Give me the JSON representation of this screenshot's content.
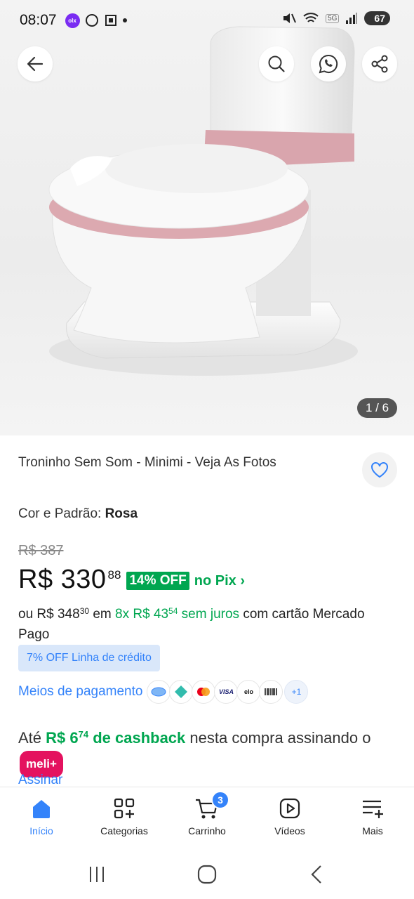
{
  "status_bar": {
    "time": "08:07",
    "app_badge": "olx",
    "network_tag": "5G",
    "battery": "67"
  },
  "hero": {
    "image_counter": "1 / 6",
    "icons": [
      "arrow-left-icon",
      "search-icon",
      "whatsapp-icon",
      "share-icon"
    ]
  },
  "product": {
    "title": "Troninho Sem Som - Minimi - Veja As Fotos",
    "variant_label": "Cor e Padrão:",
    "variant_value": "Rosa",
    "old_price": "R$ 387",
    "price_integer": "R$ 330",
    "price_cents": "88",
    "discount_badge": "14% OFF",
    "pix_label": "no Pix",
    "installments": {
      "prefix": "ou R$ 348",
      "prefix_cents": "30",
      "middle": " em ",
      "count": "8x R$ 43",
      "count_cents": "54",
      "no_interest": " sem juros",
      "suffix": " com cartão Mercado Pago"
    },
    "credit_chip": "7% OFF Linha de crédito",
    "payment_link": "Meios de pagamento",
    "payment_more": "+1",
    "cashback": {
      "prefix": "Até ",
      "amount": "R$ 6",
      "amount_cents": "74",
      "label": " de cashback",
      "suffix": " nesta compra assinando o ",
      "pill": "meli+"
    },
    "subscribe_link": "Assinar"
  },
  "bottom_nav": {
    "items": [
      {
        "label": "Início",
        "icon": "home-icon",
        "active": true
      },
      {
        "label": "Categorias",
        "icon": "categories-icon",
        "active": false
      },
      {
        "label": "Carrinho",
        "icon": "cart-icon",
        "active": false,
        "badge": "3"
      },
      {
        "label": "Vídeos",
        "icon": "video-icon",
        "active": false
      },
      {
        "label": "Mais",
        "icon": "more-icon",
        "active": false
      }
    ]
  },
  "colors": {
    "brand_blue": "#3483fa",
    "green": "#00a650",
    "meli_pink": "#e4125f"
  }
}
